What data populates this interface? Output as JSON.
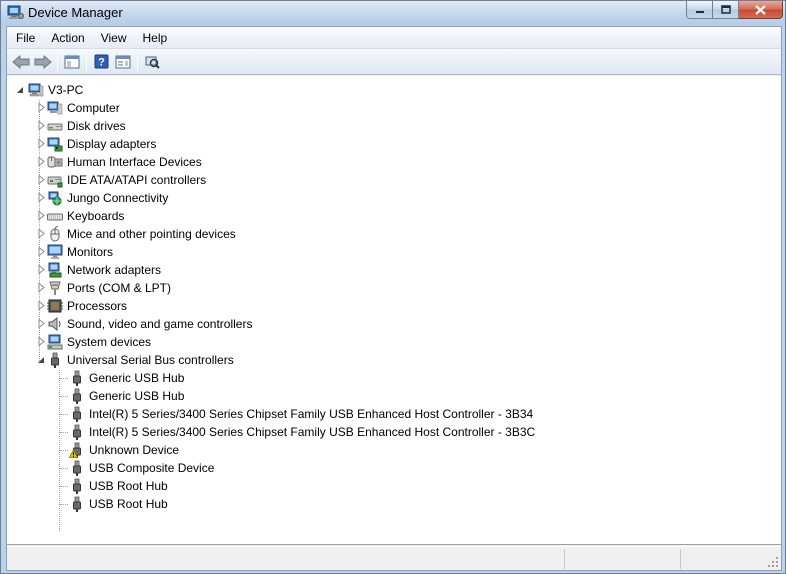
{
  "window": {
    "title": "Device Manager"
  },
  "menu": [
    "File",
    "Action",
    "View",
    "Help"
  ],
  "toolbar": {
    "buttons": [
      "back-arrow-icon",
      "forward-arrow-icon",
      "show-hide-console-tree-icon",
      "help-icon",
      "properties-icon",
      "scan-hardware-icon"
    ]
  },
  "tree": {
    "root": "V3-PC",
    "categories": [
      {
        "label": "Computer",
        "icon": "computer-icon"
      },
      {
        "label": "Disk drives",
        "icon": "disk-drive-icon"
      },
      {
        "label": "Display adapters",
        "icon": "display-adapter-icon"
      },
      {
        "label": "Human Interface Devices",
        "icon": "hid-icon"
      },
      {
        "label": "IDE ATA/ATAPI controllers",
        "icon": "ide-controller-icon"
      },
      {
        "label": "Jungo Connectivity",
        "icon": "network-globe-icon"
      },
      {
        "label": "Keyboards",
        "icon": "keyboard-icon"
      },
      {
        "label": "Mice and other pointing devices",
        "icon": "mouse-icon"
      },
      {
        "label": "Monitors",
        "icon": "monitor-icon"
      },
      {
        "label": "Network adapters",
        "icon": "network-adapter-icon"
      },
      {
        "label": "Ports (COM & LPT)",
        "icon": "port-icon"
      },
      {
        "label": "Processors",
        "icon": "processor-icon"
      },
      {
        "label": "Sound, video and game controllers",
        "icon": "speaker-icon"
      },
      {
        "label": "System devices",
        "icon": "system-devices-icon"
      },
      {
        "label": "Universal Serial Bus controllers",
        "icon": "usb-icon"
      }
    ],
    "usb_children": [
      {
        "label": "Generic USB Hub",
        "icon": "usb-icon"
      },
      {
        "label": "Generic USB Hub",
        "icon": "usb-icon"
      },
      {
        "label": "Intel(R) 5 Series/3400 Series Chipset Family USB Enhanced Host Controller - 3B34",
        "icon": "usb-icon"
      },
      {
        "label": "Intel(R) 5 Series/3400 Series Chipset Family USB Enhanced Host Controller - 3B3C",
        "icon": "usb-icon"
      },
      {
        "label": "Unknown Device",
        "icon": "usb-warning-icon"
      },
      {
        "label": "USB Composite Device",
        "icon": "usb-icon"
      },
      {
        "label": "USB Root Hub",
        "icon": "usb-icon"
      },
      {
        "label": "USB Root Hub",
        "icon": "usb-icon"
      }
    ]
  },
  "colors": {
    "window_frame": "#b9d1ea",
    "tree_background": "#ffffff",
    "warning": "#f5c400"
  }
}
